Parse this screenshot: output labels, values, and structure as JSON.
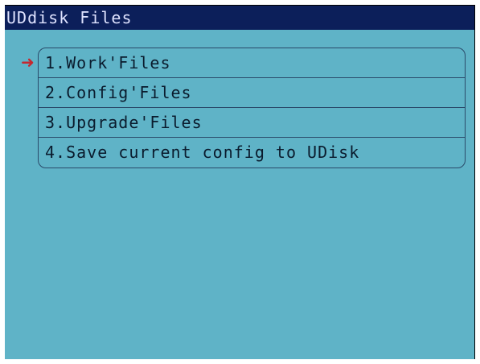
{
  "screen": {
    "title": "UDdisk Files",
    "colors": {
      "background": "#5fb3c7",
      "title_bar": "#0c1f5a",
      "title_text": "#dfe3ff",
      "pointer": "#c5282f"
    }
  },
  "menu": {
    "selected_index": 0,
    "pointer_icon": "right-arrow-icon",
    "items": [
      {
        "label": "1.Work'Files"
      },
      {
        "label": "2.Config'Files"
      },
      {
        "label": "3.Upgrade'Files"
      },
      {
        "label": "4.Save current config to UDisk"
      }
    ]
  }
}
